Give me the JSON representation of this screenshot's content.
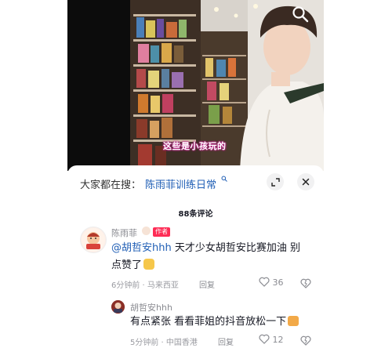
{
  "video": {
    "subtitle": "这些是小孩玩的"
  },
  "search_bar": {
    "prefix": "大家都在搜：",
    "term": "陈雨菲训练日常"
  },
  "comments_header": {
    "count_label": "88条评论"
  },
  "comments": [
    {
      "author": "陈雨菲",
      "author_badge": "作者",
      "mention": "@胡哲安hhh",
      "text_line1": " 天才少女胡哲安比赛加油 别",
      "text_line2": "点赞了",
      "time": "6分钟前",
      "location": "马来西亚",
      "reply_label": "回复",
      "likes": "36"
    },
    {
      "author": "胡哲安hhh",
      "text": "有点紧张 看看菲姐的抖音放松一下",
      "time": "5分钟前",
      "location": "中国香港",
      "reply_label": "回复",
      "likes": "12"
    }
  ],
  "colors": {
    "link": "#1f5eb5",
    "author_badge": "#fe2c55",
    "muted": "#8a8b91"
  }
}
